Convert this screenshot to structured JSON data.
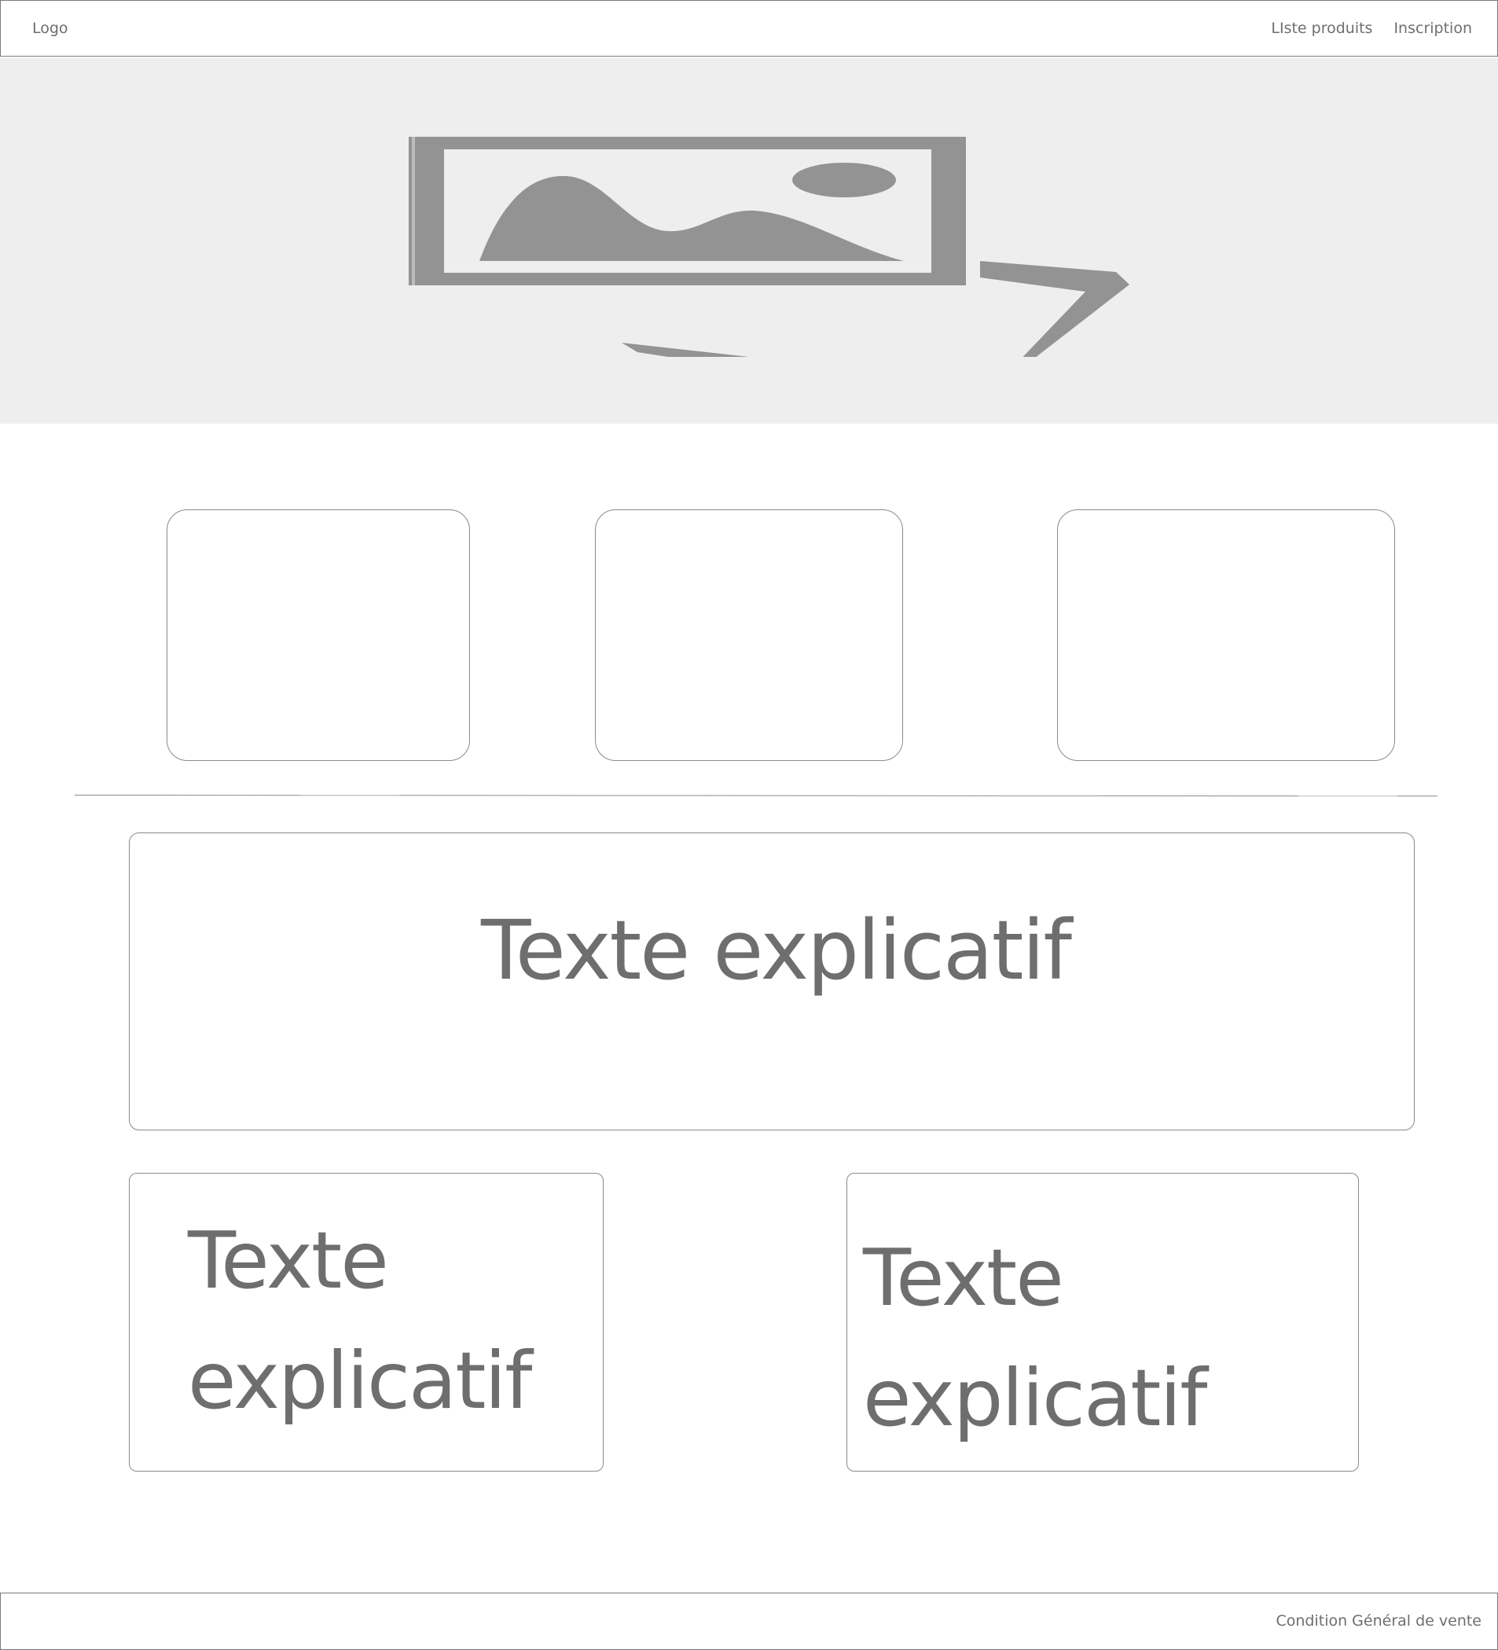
{
  "header": {
    "logo": "Logo",
    "nav": [
      {
        "label": "LIste produits"
      },
      {
        "label": "Inscription"
      }
    ]
  },
  "hero": {
    "icon": "image-placeholder-icon"
  },
  "main": {
    "wide_text": "Texte explicatif",
    "left_text": {
      "line1": "Texte",
      "line2": "explicatif"
    },
    "right_text": {
      "line1": "Texte",
      "line2": "explicatif"
    }
  },
  "footer": {
    "link": "Condition Général de vente"
  },
  "colors": {
    "border": "#8a8a8a",
    "text": "#6e6e6e",
    "hero_bg": "#eeeeee",
    "icon": "#939393"
  }
}
